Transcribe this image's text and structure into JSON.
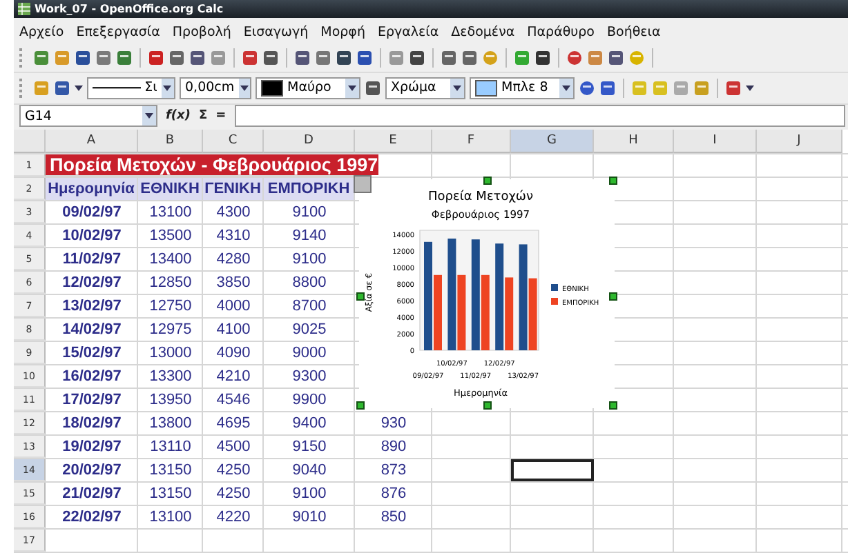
{
  "window": {
    "title": "Work_07 - OpenOffice.org Calc"
  },
  "menu": [
    "Αρχείο",
    "Επεξεργασία",
    "Προβολή",
    "Εισαγωγή",
    "Μορφή",
    "Εργαλεία",
    "Δεδομένα",
    "Παράθυρο",
    "Βοήθεια"
  ],
  "format_toolbar": {
    "line_style": "Σι",
    "line_width": "0,00cm",
    "line_color": {
      "label": "Μαύρο",
      "color": "#000000"
    },
    "area_style": "Χρώμα",
    "area_color": {
      "label": "Μπλε 8",
      "color": "#99ccff"
    }
  },
  "formula_bar": {
    "name_box": "G14",
    "function_wizard": "f(x)",
    "sum": "Σ",
    "equals": "="
  },
  "columns": [
    {
      "label": "A",
      "selected": false
    },
    {
      "label": "B",
      "selected": false
    },
    {
      "label": "C",
      "selected": false
    },
    {
      "label": "D",
      "selected": false
    },
    {
      "label": "E",
      "selected": false
    },
    {
      "label": "F",
      "selected": false
    },
    {
      "label": "G",
      "selected": true
    },
    {
      "label": "H",
      "selected": false
    },
    {
      "label": "I",
      "selected": false
    },
    {
      "label": "J",
      "selected": false
    }
  ],
  "rows": [
    {
      "number": "1",
      "selected": false,
      "kind": "title",
      "title": "Πορεία Μετοχών - Φεβρουάριος 1997"
    },
    {
      "number": "2",
      "selected": false,
      "kind": "header",
      "cells": [
        "Ημερομηνία",
        "ΕΘΝΙΚΗ",
        "ΓΕΝΙΚΗ",
        "ΕΜΠΟΡΙΚΗ"
      ]
    },
    {
      "number": "3",
      "selected": false,
      "kind": "data",
      "cells": [
        "09/02/97",
        "13100",
        "4300",
        "9100"
      ]
    },
    {
      "number": "4",
      "selected": false,
      "kind": "data",
      "cells": [
        "10/02/97",
        "13500",
        "4310",
        "9140"
      ]
    },
    {
      "number": "5",
      "selected": false,
      "kind": "data",
      "cells": [
        "11/02/97",
        "13400",
        "4280",
        "9100"
      ]
    },
    {
      "number": "6",
      "selected": false,
      "kind": "data",
      "cells": [
        "12/02/97",
        "12850",
        "3850",
        "8800"
      ]
    },
    {
      "number": "7",
      "selected": false,
      "kind": "data",
      "cells": [
        "13/02/97",
        "12750",
        "4000",
        "8700"
      ]
    },
    {
      "number": "8",
      "selected": false,
      "kind": "data",
      "cells": [
        "14/02/97",
        "12975",
        "4100",
        "9025"
      ]
    },
    {
      "number": "9",
      "selected": false,
      "kind": "data",
      "cells": [
        "15/02/97",
        "13000",
        "4090",
        "9000"
      ]
    },
    {
      "number": "10",
      "selected": false,
      "kind": "data",
      "cells": [
        "16/02/97",
        "13300",
        "4210",
        "9300"
      ]
    },
    {
      "number": "11",
      "selected": false,
      "kind": "data",
      "cells": [
        "17/02/97",
        "13950",
        "4546",
        "9900"
      ]
    },
    {
      "number": "12",
      "selected": false,
      "kind": "data",
      "cells": [
        "18/02/97",
        "13800",
        "4695",
        "9400",
        "930"
      ]
    },
    {
      "number": "13",
      "selected": false,
      "kind": "data",
      "cells": [
        "19/02/97",
        "13110",
        "4500",
        "9150",
        "890"
      ]
    },
    {
      "number": "14",
      "selected": true,
      "kind": "data",
      "cells": [
        "20/02/97",
        "13150",
        "4250",
        "9040",
        "873"
      ]
    },
    {
      "number": "15",
      "selected": false,
      "kind": "data",
      "cells": [
        "21/02/97",
        "13150",
        "4250",
        "9100",
        "876"
      ]
    },
    {
      "number": "16",
      "selected": false,
      "kind": "data",
      "cells": [
        "22/02/97",
        "13100",
        "4220",
        "9010",
        "850"
      ]
    },
    {
      "number": "17",
      "selected": false,
      "kind": "empty"
    }
  ],
  "chart": {
    "chart_data": {
      "type": "bar",
      "title": "Πορεία Μετοχών",
      "subtitle": "Φεβρουάριος 1997",
      "xlabel": "Ημερομηνία",
      "ylabel": "Αξία σε €",
      "categories": [
        "09/02/97",
        "10/02/97",
        "11/02/97",
        "12/02/97",
        "13/02/97"
      ],
      "series": [
        {
          "name": "ΕΘΝΙΚΗ",
          "color": "#1f4e8c",
          "values": [
            13100,
            13500,
            13400,
            12900,
            12800
          ]
        },
        {
          "name": "ΕΜΠΟΡΙΚΗ",
          "color": "#ee4422",
          "values": [
            9100,
            9100,
            9100,
            8800,
            8700
          ]
        }
      ],
      "legend": true,
      "ylim": [
        0,
        14000
      ],
      "yticks": [
        0,
        2000,
        4000,
        6000,
        8000,
        10000,
        12000,
        14000
      ]
    }
  }
}
